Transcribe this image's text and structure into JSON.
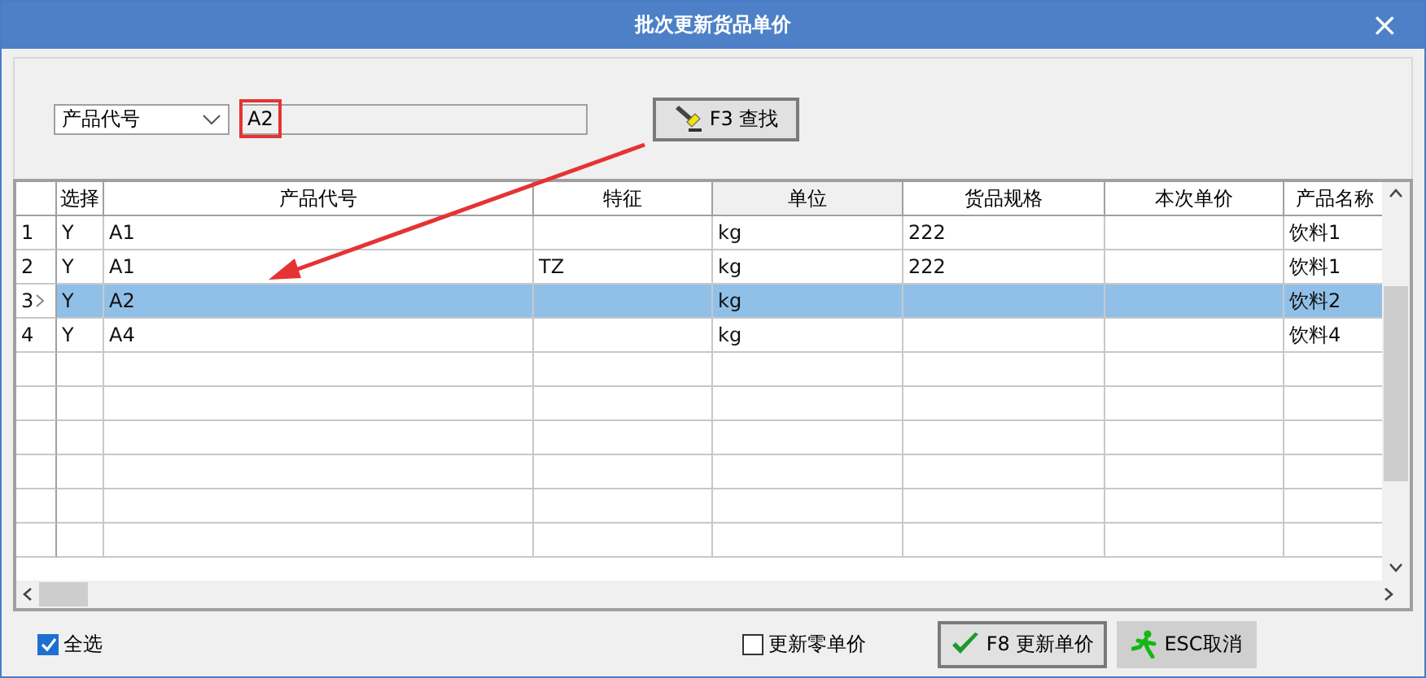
{
  "window": {
    "title": "批次更新货品单价",
    "close": "×"
  },
  "search": {
    "field": "产品代号",
    "value": "A2",
    "highlighted": true,
    "button": "F3 查找"
  },
  "table": {
    "columns": [
      "选择",
      "产品代号",
      "特征",
      "单位",
      "货品规格",
      "本次单价",
      "产品名称"
    ],
    "rows": [
      {
        "number": "1",
        "selected": false,
        "cells": [
          "Y",
          "A1",
          "",
          "kg",
          "222",
          "",
          "饮料1"
        ]
      },
      {
        "number": "2",
        "selected": false,
        "cells": [
          "Y",
          "A1",
          "TZ",
          "kg",
          "222",
          "",
          "饮料1"
        ]
      },
      {
        "number": "3",
        "selected": true,
        "cells": [
          "Y",
          "A2",
          "",
          "kg",
          "",
          "",
          "饮料2"
        ]
      },
      {
        "number": "4",
        "selected": false,
        "cells": [
          "Y",
          "A4",
          "",
          "kg",
          "",
          "",
          "饮料4"
        ]
      }
    ]
  },
  "footer": {
    "select_all": {
      "label": "全选",
      "checked": true
    },
    "update_zero": {
      "label": "更新零单价",
      "checked": false
    },
    "buttons": [
      {
        "kind": "confirm",
        "label": "F8 更新单价",
        "selected": true
      },
      {
        "kind": "cancel",
        "label": "ESC取消",
        "selected": false
      }
    ]
  }
}
